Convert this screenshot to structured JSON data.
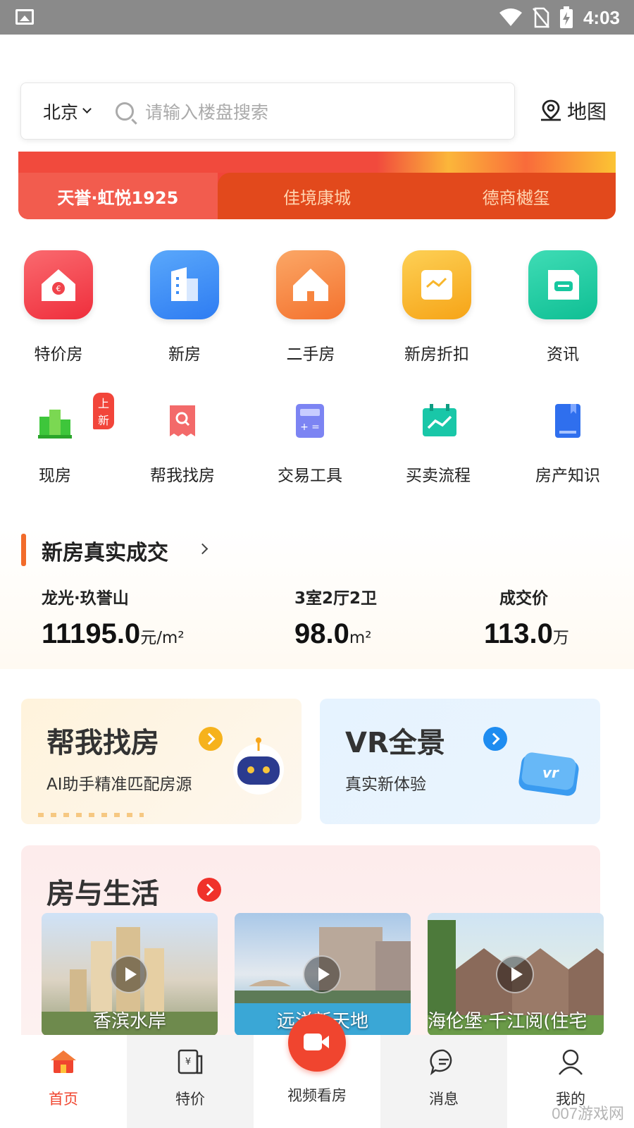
{
  "status_bar": {
    "time": "4:03"
  },
  "search": {
    "city": "北京",
    "placeholder": "请输入楼盘搜索",
    "map_label": "地图"
  },
  "banner_tabs": [
    {
      "label": "天誉·虹悦1925",
      "active": true
    },
    {
      "label": "佳境康城",
      "active": false
    },
    {
      "label": "德商樾玺",
      "active": false
    }
  ],
  "main_categories": [
    {
      "label": "特价房",
      "icon": "price-house-icon",
      "color": "#f0434b"
    },
    {
      "label": "新房",
      "icon": "new-building-icon",
      "color": "#3d8ef5"
    },
    {
      "label": "二手房",
      "icon": "second-hand-house-icon",
      "color": "#f7853f"
    },
    {
      "label": "新房折扣",
      "icon": "discount-chart-icon",
      "color": "#f8b62b"
    },
    {
      "label": "资讯",
      "icon": "news-chat-icon",
      "color": "#16c79f"
    }
  ],
  "sub_categories": [
    {
      "label": "现房",
      "icon": "ready-house-icon",
      "badge": "上新"
    },
    {
      "label": "帮我找房",
      "icon": "find-house-icon"
    },
    {
      "label": "交易工具",
      "icon": "calculator-icon"
    },
    {
      "label": "买卖流程",
      "icon": "process-chart-icon"
    },
    {
      "label": "房产知识",
      "icon": "book-icon"
    }
  ],
  "deal": {
    "title": "新房真实成交",
    "project": "龙光·玖誉山",
    "unit_price": "11195.0",
    "unit_price_unit": "元/m²",
    "layout": "3室2厅2卫",
    "area": "98.0",
    "area_unit": "m²",
    "price_label": "成交价",
    "price": "113.0",
    "price_unit": "万"
  },
  "promo_cards": [
    {
      "title": "帮我找房",
      "subtitle": "AI助手精准匹配房源"
    },
    {
      "title": "VR全景",
      "subtitle": "真实新体验"
    }
  ],
  "life": {
    "title": "房与生活",
    "videos": [
      {
        "caption": "香滨水岸"
      },
      {
        "caption": "远洋新天地"
      },
      {
        "caption": "海伦堡·千江阅(住宅"
      }
    ]
  },
  "tabbar": [
    {
      "label": "首页",
      "active": true
    },
    {
      "label": "特价",
      "active": false
    },
    {
      "label": "视频看房",
      "active": false
    },
    {
      "label": "消息",
      "active": false
    },
    {
      "label": "我的",
      "active": false
    }
  ],
  "watermark": "007游戏网"
}
